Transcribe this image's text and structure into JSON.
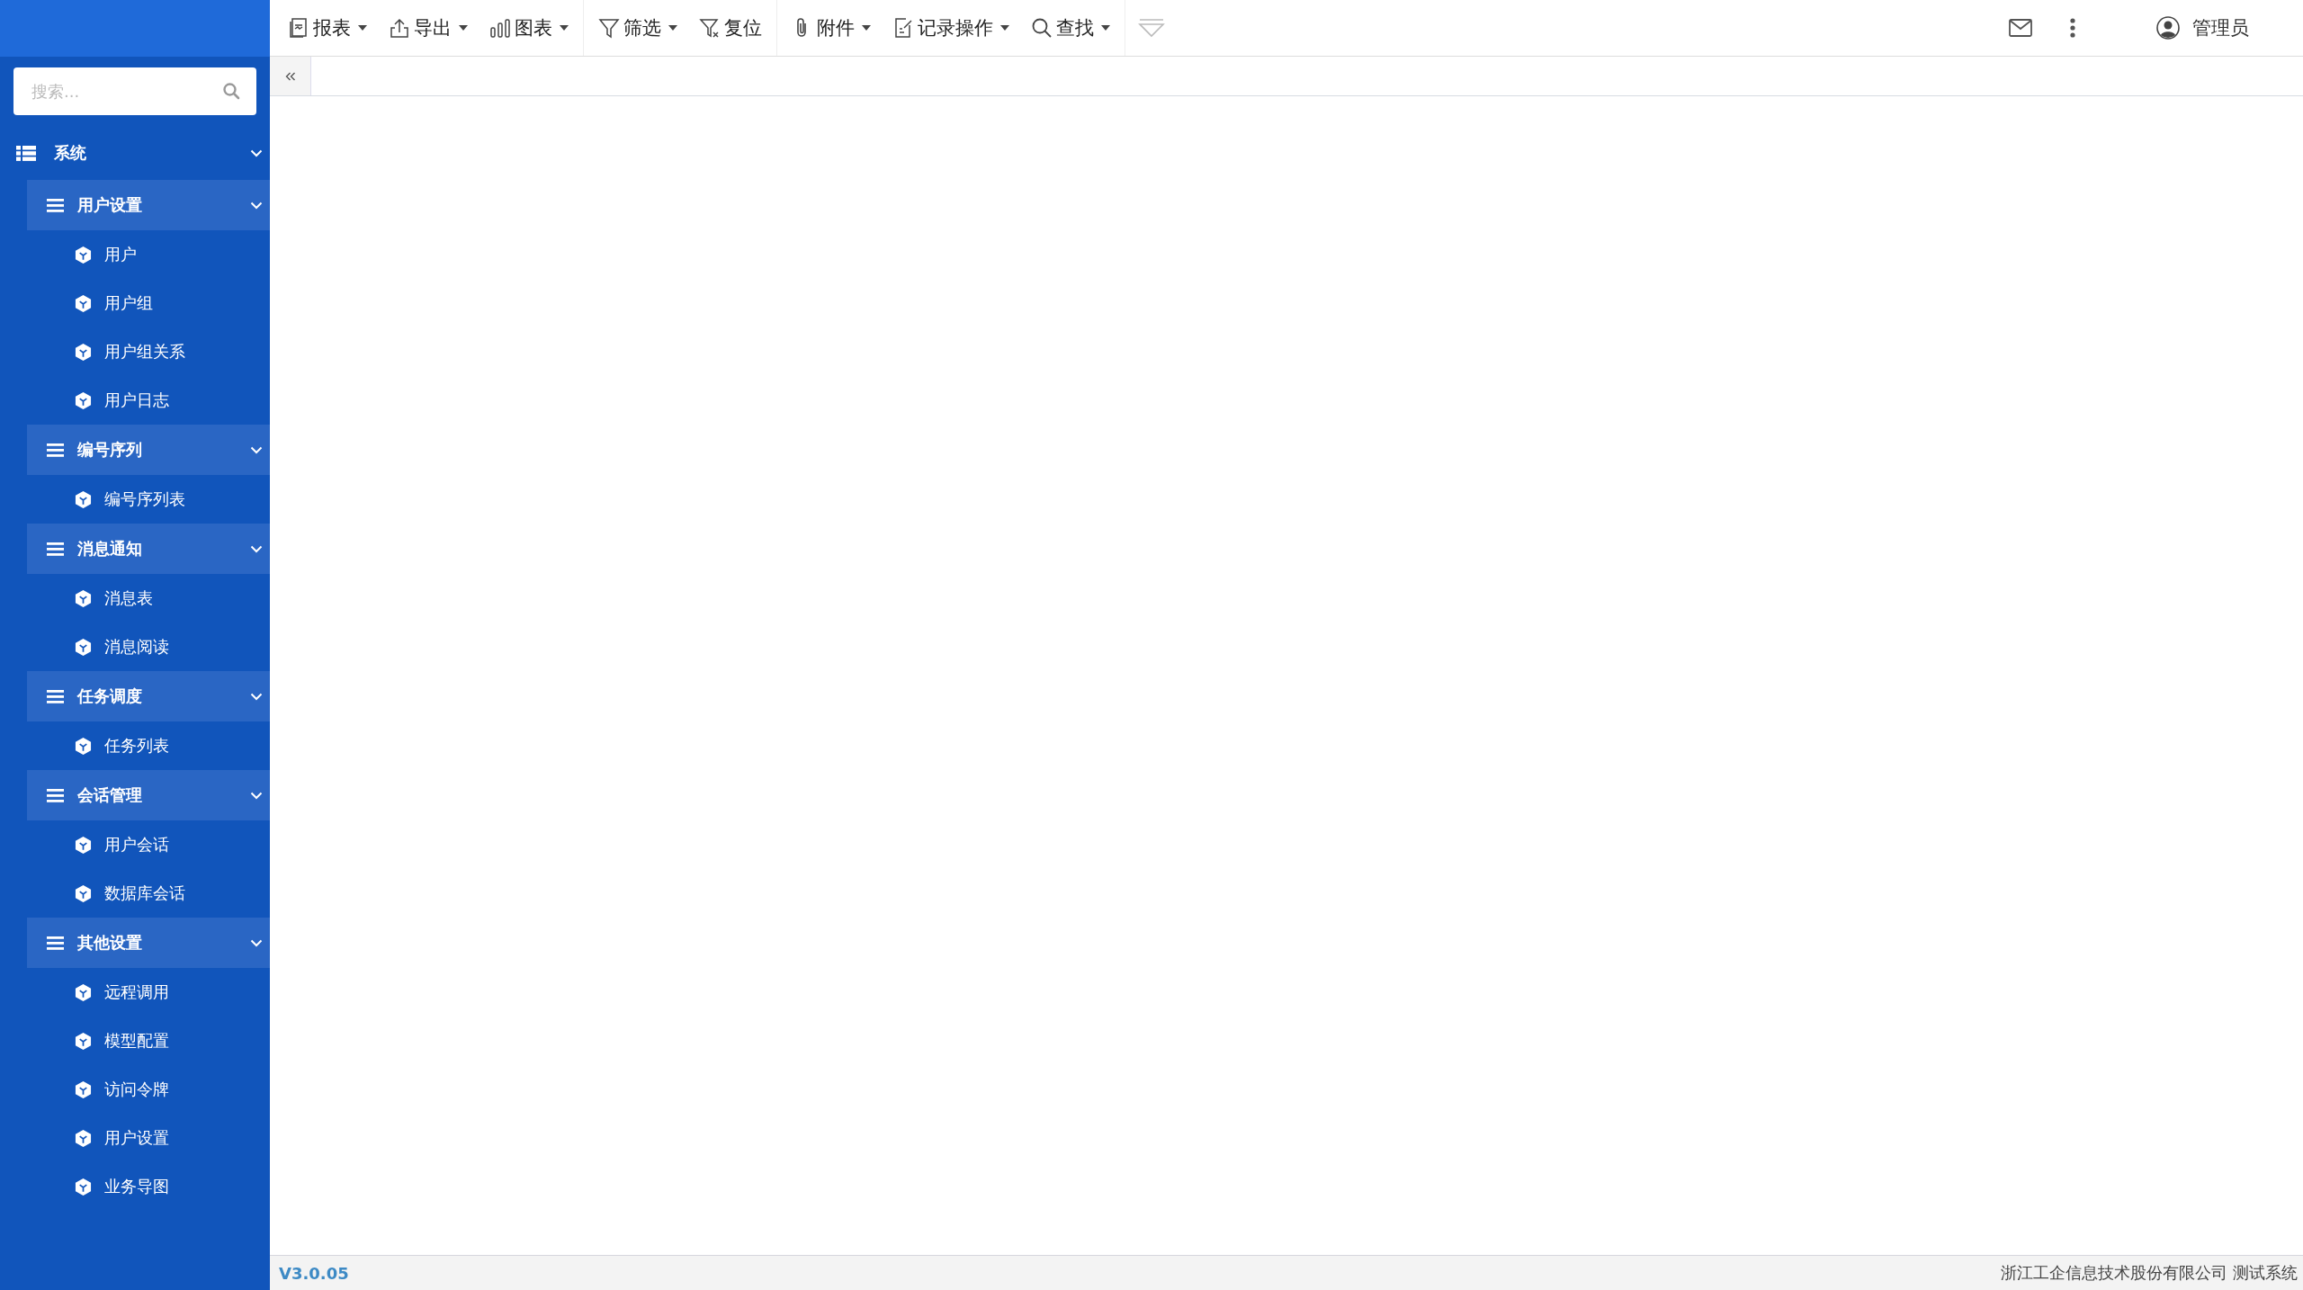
{
  "search": {
    "placeholder": "搜索..."
  },
  "menu": {
    "label": "系统",
    "expanded": true,
    "children": [
      {
        "label": "用户设置",
        "expanded": true,
        "children": [
          {
            "label": "用户"
          },
          {
            "label": "用户组"
          },
          {
            "label": "用户组关系"
          },
          {
            "label": "用户日志"
          }
        ]
      },
      {
        "label": "编号序列",
        "expanded": true,
        "children": [
          {
            "label": "编号序列表"
          }
        ]
      },
      {
        "label": "消息通知",
        "expanded": true,
        "children": [
          {
            "label": "消息表"
          },
          {
            "label": "消息阅读"
          }
        ]
      },
      {
        "label": "任务调度",
        "expanded": true,
        "children": [
          {
            "label": "任务列表"
          }
        ]
      },
      {
        "label": "会话管理",
        "expanded": true,
        "children": [
          {
            "label": "用户会话"
          },
          {
            "label": "数据库会话"
          }
        ]
      },
      {
        "label": "其他设置",
        "expanded": true,
        "children": [
          {
            "label": "远程调用"
          },
          {
            "label": "模型配置"
          },
          {
            "label": "访问令牌"
          },
          {
            "label": "用户设置"
          },
          {
            "label": "业务导图"
          }
        ]
      }
    ]
  },
  "toolbar": [
    {
      "items": [
        {
          "label": "报表",
          "dropdown": true
        },
        {
          "label": "导出",
          "dropdown": true
        },
        {
          "label": "图表",
          "dropdown": true
        }
      ]
    },
    {
      "items": [
        {
          "label": "筛选",
          "dropdown": true
        },
        {
          "label": "复位",
          "dropdown": false
        }
      ]
    },
    {
      "items": [
        {
          "label": "附件",
          "dropdown": true
        },
        {
          "label": "记录操作",
          "dropdown": true
        },
        {
          "label": "查找",
          "dropdown": true
        }
      ]
    }
  ],
  "user": {
    "name": "管理员"
  },
  "footer": {
    "version": "V3.0.05",
    "company": "浙江工企信息技术股份有限公司 测试系统"
  }
}
